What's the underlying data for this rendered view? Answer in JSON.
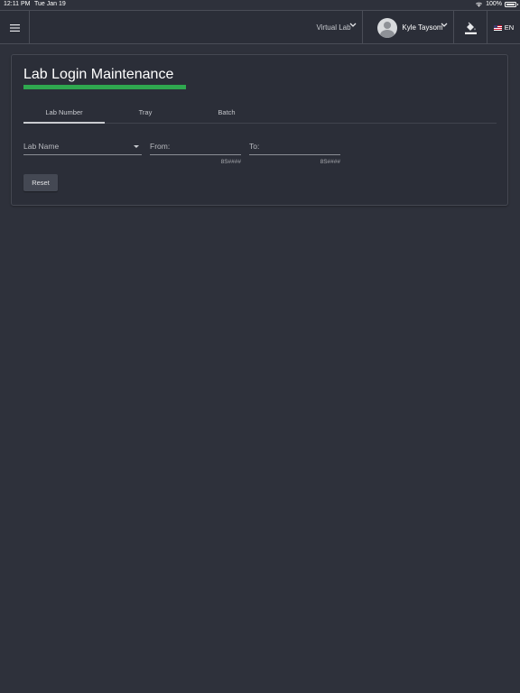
{
  "status_bar": {
    "time": "12:11 PM",
    "date": "Tue Jan 19",
    "battery": "100%"
  },
  "appbar": {
    "menu_icon": "hamburger-menu-icon",
    "lab_selector": {
      "label": "Virtual Lab",
      "icon": "chevron-down-icon"
    },
    "user": {
      "name": "Kyle Taysom",
      "icon": "chevron-down-icon",
      "avatar": "avatar-placeholder"
    },
    "theme_icon": "paint-bucket-icon",
    "language": {
      "code": "EN",
      "flag": "us-flag-icon"
    }
  },
  "card": {
    "title": "Lab Login Maintenance",
    "accent_color": "#2fa84f",
    "tabs": [
      {
        "label": "Lab Number",
        "active": true
      },
      {
        "label": "Tray",
        "active": false
      },
      {
        "label": "Batch",
        "active": false
      }
    ],
    "fields": {
      "lab_name": {
        "label": "Lab Name",
        "value": ""
      },
      "from": {
        "label": "From:",
        "value": "",
        "hint": "8S####"
      },
      "to": {
        "label": "To:",
        "value": "",
        "hint": "8S####"
      }
    },
    "reset_label": "Reset"
  },
  "colors": {
    "background": "#2e313b",
    "surface": "#2b2e38",
    "accent": "#2fa84f"
  }
}
